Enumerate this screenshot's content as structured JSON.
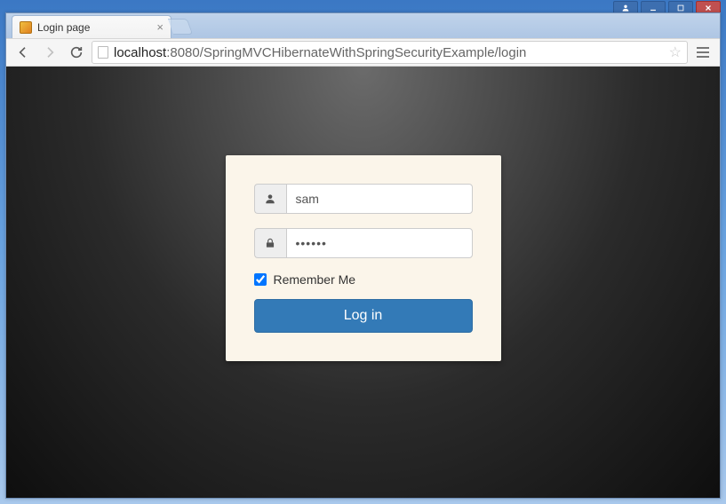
{
  "window": {
    "controls": {
      "account": "account",
      "minimize": "minimize",
      "maximize": "maximize",
      "close": "close"
    }
  },
  "browser": {
    "tab_title": "Login page",
    "url_host": "localhost",
    "url_rest": ":8080/SpringMVCHibernateWithSpringSecurityExample/login"
  },
  "login": {
    "username_value": "sam",
    "password_masked": "••••••",
    "remember_label": "Remember Me",
    "remember_checked": true,
    "submit_label": "Log in"
  }
}
